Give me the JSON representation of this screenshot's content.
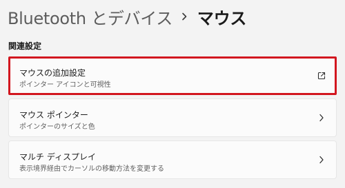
{
  "header": {
    "parent": "Bluetooth とデバイス",
    "separator_icon": "chevron-right-icon",
    "current": "マウス"
  },
  "related_settings": {
    "heading": "関連設定",
    "items": [
      {
        "title": "マウスの追加設定",
        "description": "ポインター アイコンと可視性",
        "icon": "open-external-icon",
        "highlighted": true
      },
      {
        "title": "マウス ポインター",
        "description": "ポインターのサイズと色",
        "icon": "chevron-right-icon"
      },
      {
        "title": "マルチ ディスプレイ",
        "description": "表示境界経由でカーソルの移動方法を変更する",
        "icon": "chevron-right-icon"
      }
    ]
  },
  "colors": {
    "background": "#f3f3f3",
    "card": "#fbfbfb",
    "highlight_border": "#d2161f"
  }
}
